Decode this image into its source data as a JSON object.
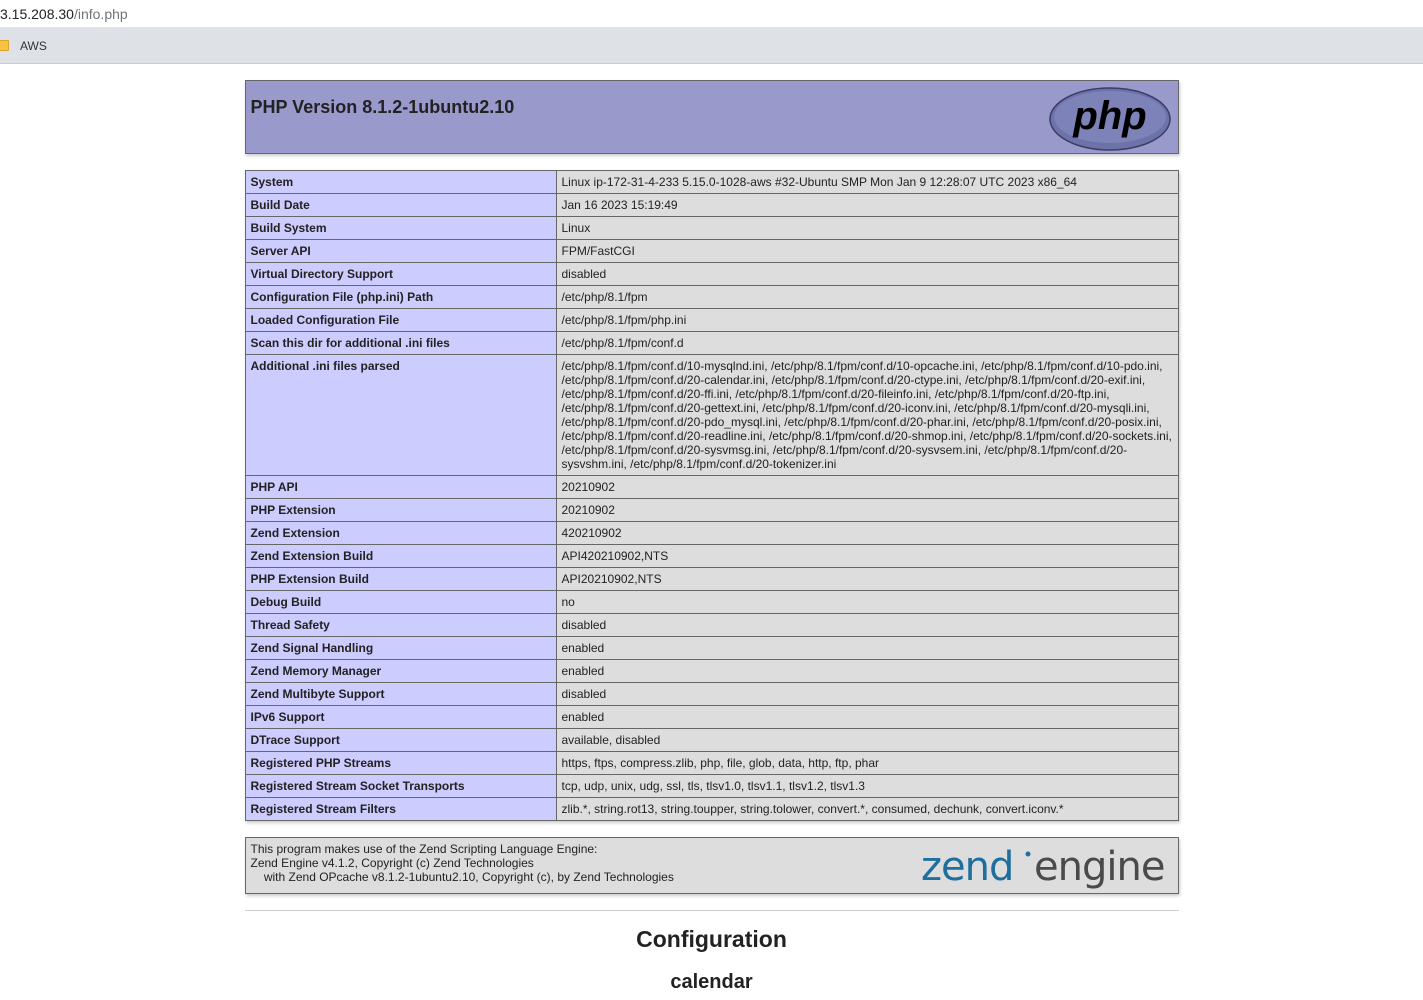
{
  "browser": {
    "url_host": "3.15.208.30",
    "url_path": "/info.php",
    "bookmark": "AWS"
  },
  "header": {
    "title": "PHP Version 8.1.2-1ubuntu2.10",
    "logo_text": "php"
  },
  "info_rows": [
    {
      "key": "System",
      "value": "Linux ip-172-31-4-233 5.15.0-1028-aws #32-Ubuntu SMP Mon Jan 9 12:28:07 UTC 2023 x86_64"
    },
    {
      "key": "Build Date",
      "value": "Jan 16 2023 15:19:49"
    },
    {
      "key": "Build System",
      "value": "Linux"
    },
    {
      "key": "Server API",
      "value": "FPM/FastCGI"
    },
    {
      "key": "Virtual Directory Support",
      "value": "disabled"
    },
    {
      "key": "Configuration File (php.ini) Path",
      "value": "/etc/php/8.1/fpm"
    },
    {
      "key": "Loaded Configuration File",
      "value": "/etc/php/8.1/fpm/php.ini"
    },
    {
      "key": "Scan this dir for additional .ini files",
      "value": "/etc/php/8.1/fpm/conf.d"
    },
    {
      "key": "Additional .ini files parsed",
      "value": "/etc/php/8.1/fpm/conf.d/10-mysqlnd.ini, /etc/php/8.1/fpm/conf.d/10-opcache.ini, /etc/php/8.1/fpm/conf.d/10-pdo.ini, /etc/php/8.1/fpm/conf.d/20-calendar.ini, /etc/php/8.1/fpm/conf.d/20-ctype.ini, /etc/php/8.1/fpm/conf.d/20-exif.ini, /etc/php/8.1/fpm/conf.d/20-ffi.ini, /etc/php/8.1/fpm/conf.d/20-fileinfo.ini, /etc/php/8.1/fpm/conf.d/20-ftp.ini, /etc/php/8.1/fpm/conf.d/20-gettext.ini, /etc/php/8.1/fpm/conf.d/20-iconv.ini, /etc/php/8.1/fpm/conf.d/20-mysqli.ini, /etc/php/8.1/fpm/conf.d/20-pdo_mysql.ini, /etc/php/8.1/fpm/conf.d/20-phar.ini, /etc/php/8.1/fpm/conf.d/20-posix.ini, /etc/php/8.1/fpm/conf.d/20-readline.ini, /etc/php/8.1/fpm/conf.d/20-shmop.ini, /etc/php/8.1/fpm/conf.d/20-sockets.ini, /etc/php/8.1/fpm/conf.d/20-sysvmsg.ini, /etc/php/8.1/fpm/conf.d/20-sysvsem.ini, /etc/php/8.1/fpm/conf.d/20-sysvshm.ini, /etc/php/8.1/fpm/conf.d/20-tokenizer.ini"
    },
    {
      "key": "PHP API",
      "value": "20210902"
    },
    {
      "key": "PHP Extension",
      "value": "20210902"
    },
    {
      "key": "Zend Extension",
      "value": "420210902"
    },
    {
      "key": "Zend Extension Build",
      "value": "API420210902,NTS"
    },
    {
      "key": "PHP Extension Build",
      "value": "API20210902,NTS"
    },
    {
      "key": "Debug Build",
      "value": "no"
    },
    {
      "key": "Thread Safety",
      "value": "disabled"
    },
    {
      "key": "Zend Signal Handling",
      "value": "enabled"
    },
    {
      "key": "Zend Memory Manager",
      "value": "enabled"
    },
    {
      "key": "Zend Multibyte Support",
      "value": "disabled"
    },
    {
      "key": "IPv6 Support",
      "value": "enabled"
    },
    {
      "key": "DTrace Support",
      "value": "available, disabled"
    },
    {
      "key": "Registered PHP Streams",
      "value": "https, ftps, compress.zlib, php, file, glob, data, http, ftp, phar"
    },
    {
      "key": "Registered Stream Socket Transports",
      "value": "tcp, udp, unix, udg, ssl, tls, tlsv1.0, tlsv1.1, tlsv1.2, tlsv1.3"
    },
    {
      "key": "Registered Stream Filters",
      "value": "zlib.*, string.rot13, string.toupper, string.tolower, convert.*, consumed, dechunk, convert.iconv.*"
    }
  ],
  "zend": {
    "line1": "This program makes use of the Zend Scripting Language Engine:",
    "line2": "Zend Engine v4.1.2, Copyright (c) Zend Technologies",
    "line3": "    with Zend OPcache v8.1.2-1ubuntu2.10, Copyright (c), by Zend Technologies",
    "logo_word1": "zend",
    "logo_word2": "engine"
  },
  "sections": {
    "configuration_heading": "Configuration",
    "first_module": "calendar"
  },
  "colors": {
    "header_bg": "#9999cc",
    "key_bg": "#ccccff",
    "value_bg": "#dddddd"
  }
}
